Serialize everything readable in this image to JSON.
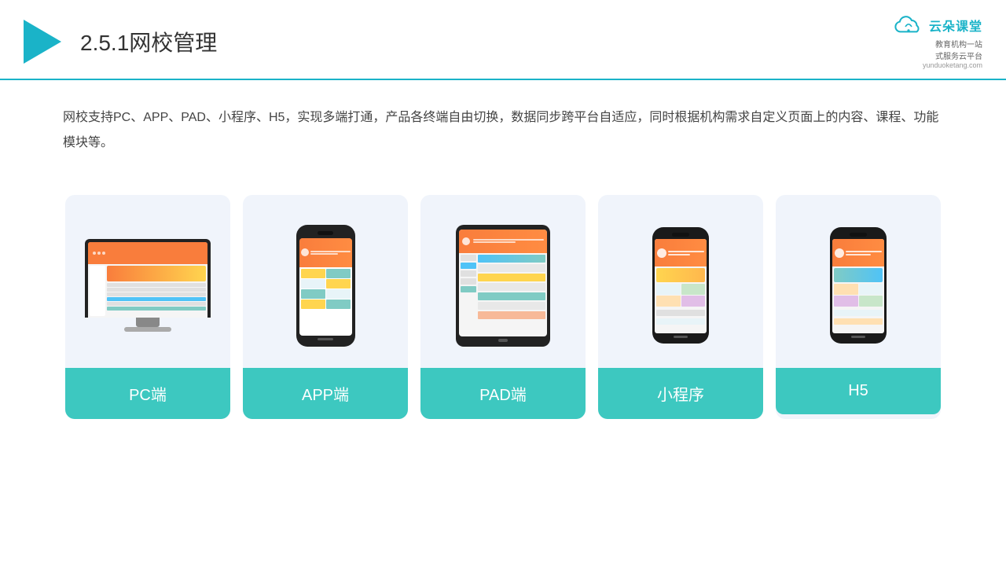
{
  "header": {
    "section_number": "2.5.1",
    "title": "网校管理",
    "brand_name": "云朵课堂",
    "brand_url": "yunduoketang.com",
    "brand_tagline": "教育机构一站",
    "brand_tagline2": "式服务云平台"
  },
  "description": {
    "text": "网校支持PC、APP、PAD、小程序、H5，实现多端打通，产品各终端自由切换，数据同步跨平台自适应，同时根据机构需求自定义页面上的内容、课程、功能模块等。"
  },
  "cards": [
    {
      "id": "pc",
      "label": "PC端"
    },
    {
      "id": "app",
      "label": "APP端"
    },
    {
      "id": "pad",
      "label": "PAD端"
    },
    {
      "id": "miniprogram",
      "label": "小程序"
    },
    {
      "id": "h5",
      "label": "H5"
    }
  ],
  "colors": {
    "accent": "#1ab3c8",
    "card_label_bg": "#3dc8c0",
    "card_bg": "#f0f4fb"
  }
}
